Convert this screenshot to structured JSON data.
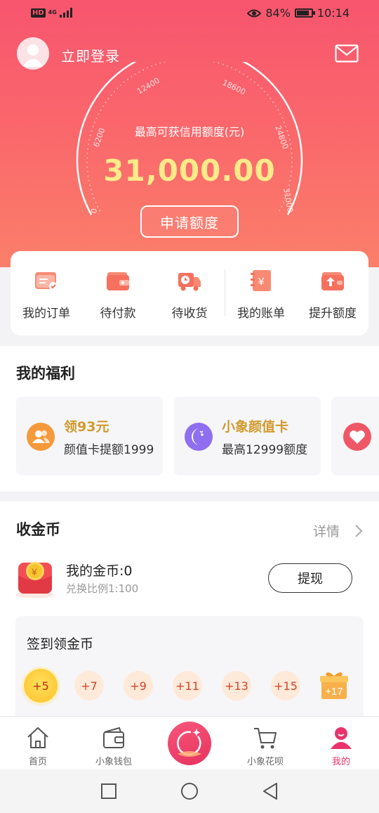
{
  "status_bar": {
    "hd": "HD",
    "network": "4G",
    "battery_pct": "84%",
    "time": "10:14"
  },
  "header": {
    "login_label": "立即登录"
  },
  "gauge": {
    "ticks": [
      "0",
      "6200",
      "12400",
      "18600",
      "24800",
      "31000"
    ]
  },
  "credit": {
    "label": "最高可获信用额度(元)",
    "amount": "31,000.00",
    "apply_label": "申请额度"
  },
  "quick_actions": [
    {
      "label": "我的订单",
      "icon": "order-icon"
    },
    {
      "label": "待付款",
      "icon": "wallet-icon"
    },
    {
      "label": "待收货",
      "icon": "delivery-truck-icon"
    },
    {
      "label": "我的账单",
      "icon": "bill-icon"
    },
    {
      "label": "提升额度",
      "icon": "raise-limit-icon"
    }
  ],
  "welfare": {
    "title": "我的福利",
    "cards": [
      {
        "title": "领93元",
        "subtitle": "颜值卡提额1999",
        "icon": "users-icon",
        "color": "#f49a3c"
      },
      {
        "title": "小象颜值卡",
        "subtitle": "最高12999额度",
        "icon": "face-card-icon",
        "color": "#8f6ff0"
      },
      {
        "title": "",
        "subtitle": "",
        "icon": "heart-icon",
        "color": "#ef5767"
      }
    ]
  },
  "coins": {
    "title": "收金币",
    "detail_label": "详情",
    "my_coins": "我的金币:0",
    "ratio": "兑换比例1:100",
    "withdraw_label": "提现",
    "checkin_title": "签到领金币",
    "days": [
      "+5",
      "+7",
      "+9",
      "+11",
      "+13",
      "+15",
      "+17"
    ]
  },
  "tabbar": [
    {
      "label": "首页",
      "icon": "home-icon",
      "active": false
    },
    {
      "label": "小象钱包",
      "icon": "wallet-tab-icon",
      "active": false
    },
    {
      "label": "",
      "icon": "center-action-icon",
      "active": false
    },
    {
      "label": "小象花呗",
      "icon": "cart-icon",
      "active": false
    },
    {
      "label": "我的",
      "icon": "profile-icon",
      "active": true
    }
  ],
  "colors": {
    "brand": "#f8556e",
    "accent_gold": "#ffea8a",
    "active_tab": "#e8346a",
    "welfare_gold": "#d29a2e"
  }
}
